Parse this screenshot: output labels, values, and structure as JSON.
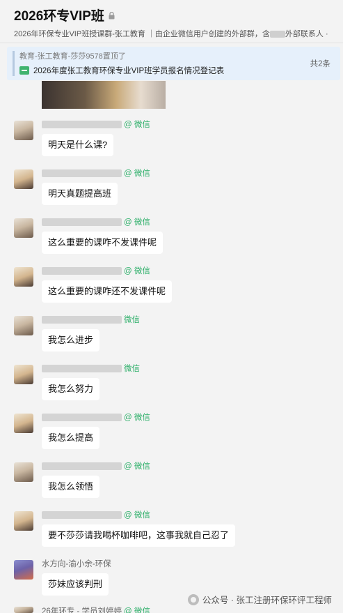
{
  "header": {
    "title": "2026环专VIP班",
    "subtitle_a": "2026年环保专业VIP班授课群-张工教育 ｜由企业微信用户创建的外部群，含",
    "subtitle_b": "外部联系人 · 群主"
  },
  "pinned": {
    "pinned_by": "教育-张工教育-莎莎9578置顶了",
    "doc_title": "2026年度张工教育环保专业VIP班学员报名情况登记表",
    "count": "共2条"
  },
  "wechat_tag": "@ 微信",
  "messages": [
    {
      "avatar": "av-a",
      "name_visible": false,
      "tag": "@ 微信",
      "text": "明天是什么课?"
    },
    {
      "avatar": "av-b",
      "name_visible": false,
      "tag": "@ 微信",
      "text": "明天真题提高班"
    },
    {
      "avatar": "av-a",
      "name_visible": false,
      "tag": "@ 微信",
      "text": "这么重要的课咋不发课件呢"
    },
    {
      "avatar": "av-b",
      "name_visible": false,
      "tag": "@ 微信",
      "text": "这么重要的课咋还不发课件呢"
    },
    {
      "avatar": "av-a",
      "name_visible": false,
      "tag": "微信",
      "text": "我怎么进步"
    },
    {
      "avatar": "av-b",
      "name_visible": false,
      "tag": "微信",
      "text": "我怎么努力"
    },
    {
      "avatar": "av-b",
      "name_visible": false,
      "tag": "@ 微信",
      "text": "我怎么提高"
    },
    {
      "avatar": "av-a",
      "name_visible": false,
      "tag": "@ 微信",
      "text": "我怎么领悟"
    },
    {
      "avatar": "av-b",
      "name_visible": false,
      "tag": "@ 微信",
      "text": "要不莎莎请我喝杯咖啡吧，这事我就自己忍了"
    },
    {
      "avatar": "av-c",
      "name_visible": true,
      "name": "水方向-渝小余-环保",
      "text": "莎妹应该判刑"
    }
  ],
  "bottom_message": {
    "name": "26年环专 - 学员刘婷婷",
    "tag": "@ 微信"
  },
  "watermark": "公众号 · 张工注册环保环评工程师"
}
